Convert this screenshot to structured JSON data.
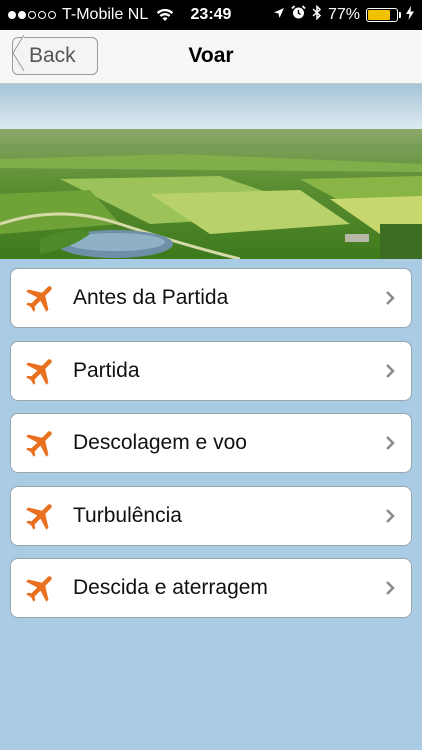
{
  "status": {
    "carrier": "T-Mobile NL",
    "time": "23:49",
    "battery_percent": "77%",
    "battery_level": 0.77,
    "signal_bars_filled": 2,
    "signal_bars_total": 5
  },
  "nav": {
    "back_label": "Back",
    "title": "Voar"
  },
  "colors": {
    "accent": "#e8701e",
    "background": "#a9cbe3",
    "battery": "#f2c200"
  },
  "menu": {
    "items": [
      {
        "label": "Antes da Partida",
        "icon": "airplane-icon"
      },
      {
        "label": "Partida",
        "icon": "airplane-icon"
      },
      {
        "label": "Descolagem e voo",
        "icon": "airplane-icon"
      },
      {
        "label": "Turbulência",
        "icon": "airplane-icon"
      },
      {
        "label": "Descida e aterragem",
        "icon": "airplane-icon"
      }
    ]
  }
}
